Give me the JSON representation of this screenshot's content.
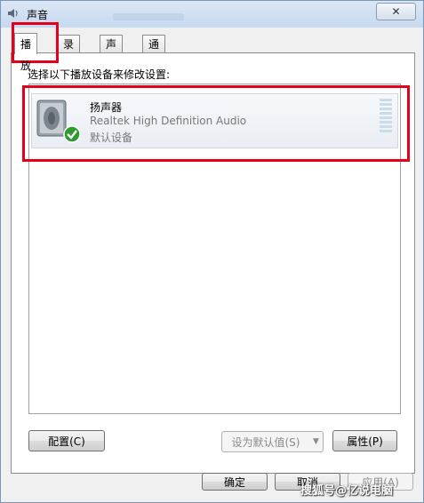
{
  "window": {
    "title": "声音",
    "close_glyph": "✕"
  },
  "tabs": [
    {
      "label": "播放"
    },
    {
      "label": "录制"
    },
    {
      "label": "声音"
    },
    {
      "label": "通信"
    }
  ],
  "panel": {
    "instruction": "选择以下播放设备来修改设置:"
  },
  "device": {
    "name": "扬声器",
    "description": "Realtek High Definition Audio",
    "status": "默认设备",
    "icon": "speaker-icon",
    "status_icon": "check-icon"
  },
  "buttons": {
    "configure": "配置(C)",
    "set_default": "设为默认值(S)",
    "properties": "属性(P)",
    "ok": "确定",
    "cancel": "取消",
    "apply": "应用(A)"
  },
  "watermark": "搜狐号@亿说电脑",
  "colors": {
    "highlight_box": "#e4001b",
    "check": "#2e9b2e"
  }
}
